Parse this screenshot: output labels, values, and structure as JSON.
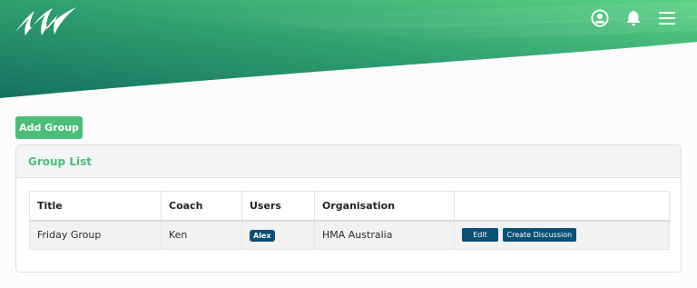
{
  "header": {
    "brand_icon": "swoosh-logo",
    "icons": [
      "user-circle-icon",
      "bell-icon",
      "hamburger-menu-icon"
    ],
    "colors": {
      "gradient_dark": "#1e7a63",
      "gradient_light": "#55cf7f"
    }
  },
  "actions": {
    "add_group_label": "Add Group"
  },
  "group_list": {
    "title": "Group List",
    "columns": [
      "Title",
      "Coach",
      "Users",
      "Organisation",
      ""
    ],
    "rows": [
      {
        "title": "Friday Group",
        "coach": "Ken",
        "users": [
          "Alex"
        ],
        "organisation": "HMA Australia",
        "edit_label": "Edit",
        "discussion_label": "Create Discussion"
      }
    ]
  },
  "colors": {
    "accent_green": "#4bbf78",
    "primary_navy": "#0a4f74"
  }
}
